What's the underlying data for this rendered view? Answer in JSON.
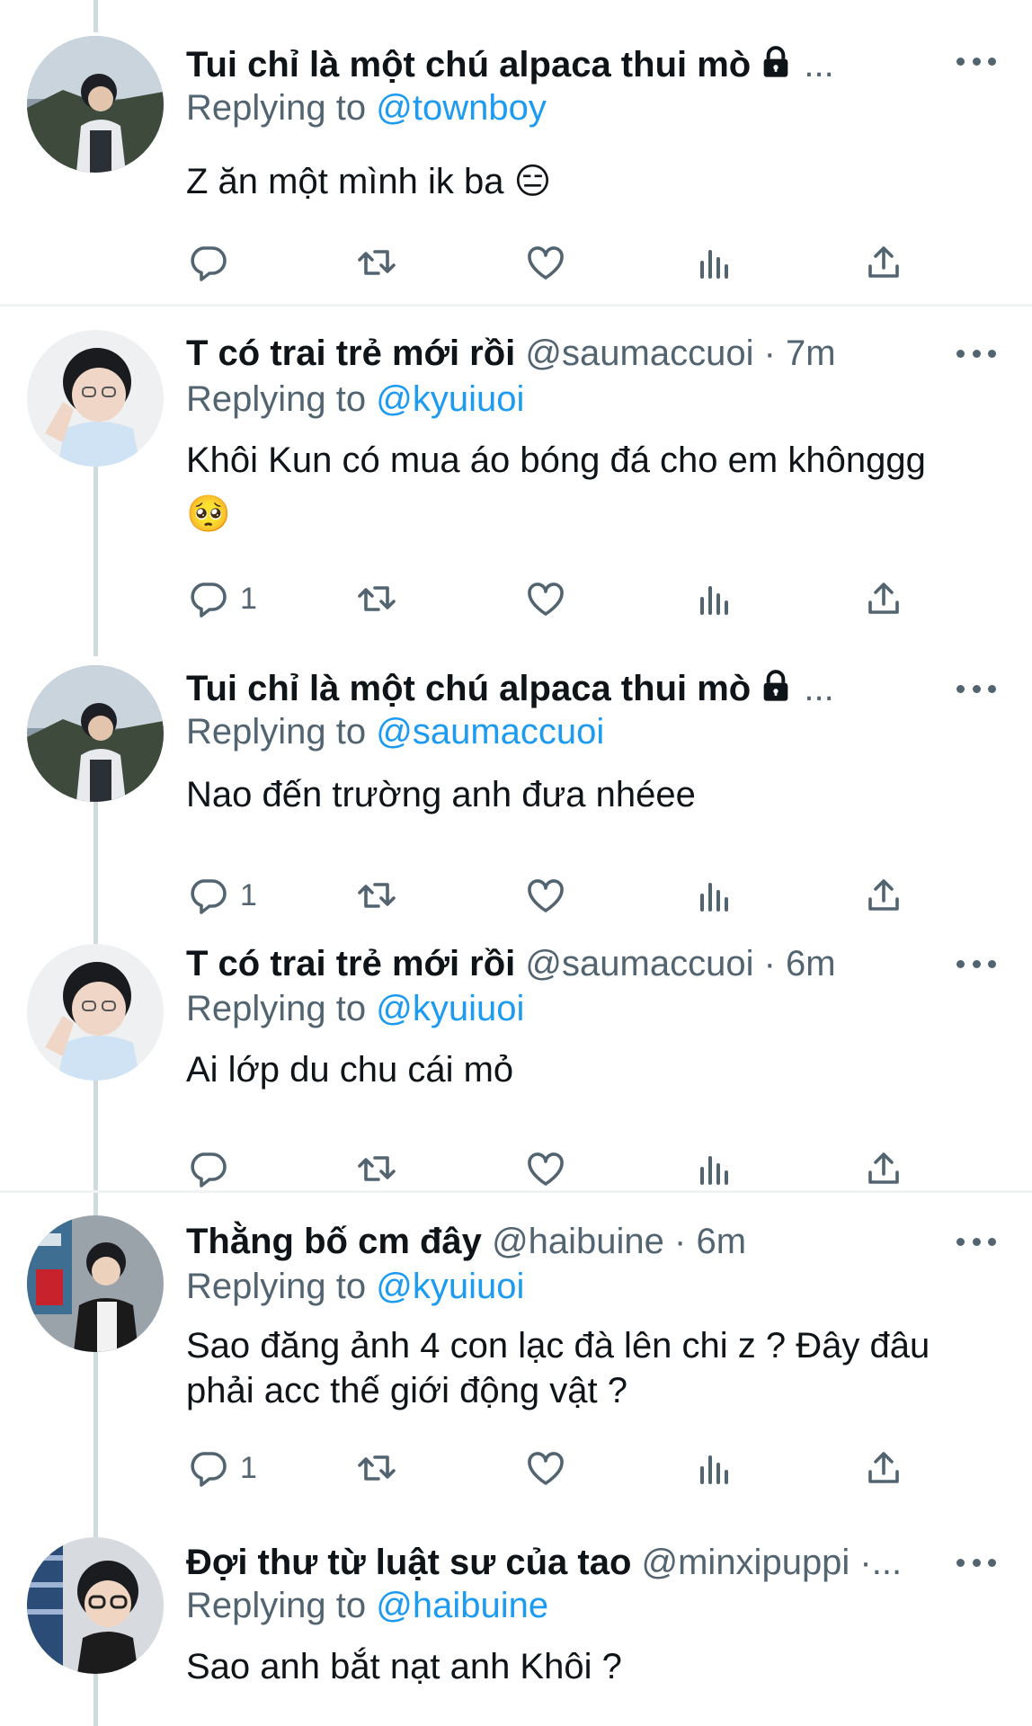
{
  "colors": {
    "link": "#1d9bf0",
    "secondary": "#536471",
    "text": "#0f1419"
  },
  "replying_prefix": "Replying to",
  "tweets": [
    {
      "name": "Tui chỉ là một chú alpaca thui mò",
      "handle_time": "...",
      "locked": true,
      "reply_to": "@townboy",
      "text": "Z ăn một mình ik ba 😑",
      "reply_count": ""
    },
    {
      "name": "T có trai trẻ mới rồi",
      "handle_time": "@saumaccuoi · 7m",
      "locked": false,
      "reply_to": "@kyuiuoi",
      "text": "Khôi Kun có mua áo bóng đá cho em khônggg",
      "emoji": "🥺",
      "reply_count": "1"
    },
    {
      "name": "Tui chỉ là một chú alpaca thui mò",
      "handle_time": "...",
      "locked": true,
      "reply_to": "@saumaccuoi",
      "text": "Nao đến trường anh đưa nhéee",
      "reply_count": "1"
    },
    {
      "name": "T có trai trẻ mới rồi",
      "handle_time": "@saumaccuoi · 6m",
      "locked": false,
      "reply_to": "@kyuiuoi",
      "text": "Ai lớp du chu cái mỏ",
      "reply_count": ""
    },
    {
      "name": "Thằng bố cm đây",
      "handle_time": "@haibuine · 6m",
      "locked": false,
      "reply_to": "@kyuiuoi",
      "text_line1": "Sao đăng ảnh 4 con lạc đà lên chi z ? Đây đâu",
      "text_line2": "phải acc thế giới động vật ?",
      "reply_count": "1"
    },
    {
      "name": "Đợi thư từ luật sư của tao",
      "handle_time": "@minxipuppi ·...",
      "locked": false,
      "reply_to": "@haibuine",
      "text": "Sao anh bắt nạt anh Khôi ?"
    }
  ],
  "icons": [
    "reply-icon",
    "retweet-icon",
    "like-icon",
    "analytics-icon",
    "share-icon",
    "more-icon",
    "lock-icon"
  ]
}
